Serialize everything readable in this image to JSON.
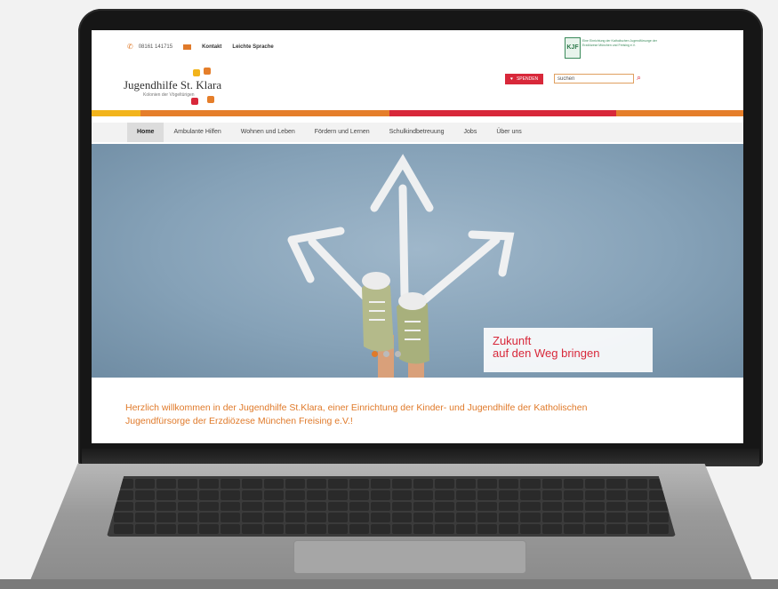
{
  "header": {
    "phone": "08161 141715",
    "contact_link": "Kontakt",
    "easy_language_link": "Leichte Sprache"
  },
  "logo": {
    "title": "Jugendhilfe St. Klara",
    "subtitle": "Kolonien der Vögeltürigen"
  },
  "sponsor": {
    "badge": "KJF",
    "text": "Eine Einrichtung der Katholischen Jugendfürsorge der Erzdiözese München und Freising e.V."
  },
  "donate_label": "SPENDEN",
  "search": {
    "value": "suchen"
  },
  "colors": {
    "yellow": "#f2b41c",
    "orange": "#e57e2a",
    "red": "#d8283a",
    "nav_bg": "#f2f2f2"
  },
  "nav": {
    "items": [
      {
        "label": "Home"
      },
      {
        "label": "Ambulante Hilfen"
      },
      {
        "label": "Wohnen und Leben"
      },
      {
        "label": "Fördern und Lernen"
      },
      {
        "label": "Schulkindbetreuung"
      },
      {
        "label": "Jobs"
      },
      {
        "label": "Über uns"
      }
    ]
  },
  "hero": {
    "caption_line1": "Zukunft",
    "caption_line2": "auf den Weg bringen",
    "slide_count": 3,
    "active_slide": 1
  },
  "welcome_text": "Herzlich willkommen in der Jugendhilfe St.Klara, einer Einrichtung der Kinder- und Jugendhilfe der Katholischen Jugendfürsorge der Erzdiözese München Freising e.V.!"
}
